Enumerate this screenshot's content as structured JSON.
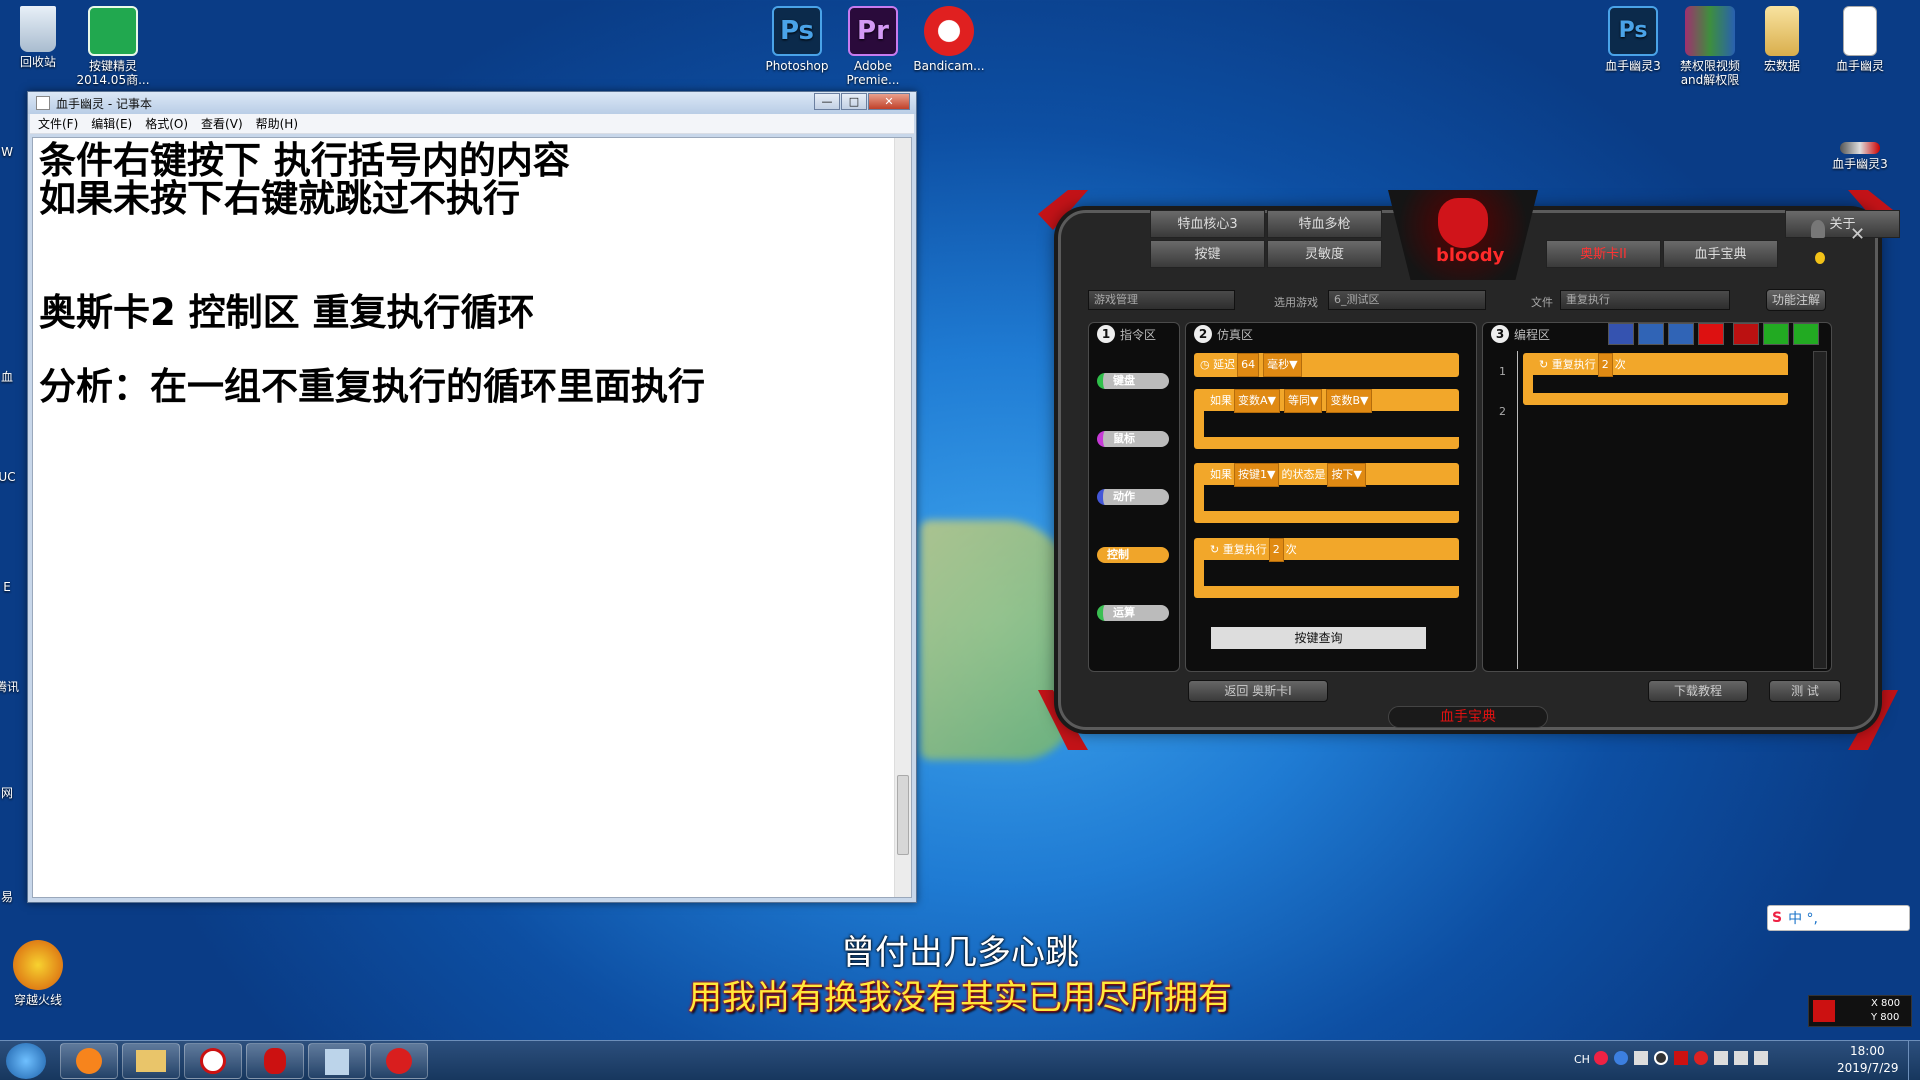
{
  "desktop": {
    "icons": [
      {
        "label": "回收站"
      },
      {
        "label": "按键精灵\n2014.05商..."
      },
      {
        "label": "Photoshop"
      },
      {
        "label": "Adobe\nPremie..."
      },
      {
        "label": "Bandicam..."
      },
      {
        "label": "血手幽灵3"
      },
      {
        "label": "禁权限视频\nand解权限"
      },
      {
        "label": "宏数据"
      },
      {
        "label": "血手幽灵"
      },
      {
        "label": "血手幽灵3"
      },
      {
        "label": "穿越火线"
      }
    ],
    "partial_labels": [
      "W",
      "血",
      "UC",
      "E",
      "腾讯",
      "网",
      "易"
    ]
  },
  "notepad": {
    "title": "血手幽灵 - 记事本",
    "menu": [
      "文件(F)",
      "编辑(E)",
      "格式(O)",
      "查看(V)",
      "帮助(H)"
    ],
    "window_buttons": [
      "—",
      "□",
      "✕"
    ],
    "lines": [
      "条件右键按下 执行括号内的内容",
      "如果未按下右键就跳过不执行",
      "",
      "",
      "奥斯卡2 控制区 重复执行循环",
      "",
      "分析：在一组不重复执行的循环里面执行"
    ]
  },
  "bloody": {
    "tabs_left_top": [
      "特血核心3",
      "特血多枪"
    ],
    "tabs_left_bottom": [
      "按键",
      "灵敏度"
    ],
    "tabs_right_top": [
      "关于"
    ],
    "tabs_right_bottom": [
      "奥斯卡II",
      "血手宝典"
    ],
    "logo": "bloody",
    "game_manage": "游戏管理",
    "select_game_label": "选用游戏",
    "select_game_value": "6_测试区",
    "file_label": "文件",
    "file_value": "重复执行",
    "func_btn": "功能注解",
    "panel1": {
      "num": "1",
      "title": "指令区",
      "cats": [
        "键盘",
        "鼠标",
        "动作",
        "控制",
        "运算"
      ],
      "cat_colors": [
        "#2fbf4a",
        "#c63ad6",
        "#4457d8",
        "#f0a52a",
        "#3bbf52"
      ]
    },
    "panel2": {
      "num": "2",
      "title": "仿真区",
      "b1": [
        "延迟",
        "64",
        "毫秒▼"
      ],
      "b2": [
        "如果",
        "变数A▼",
        "等同▼",
        "变数B▼"
      ],
      "b3": [
        "如果",
        "按键1▼",
        "的状态是",
        "按下▼"
      ],
      "b4": [
        "重复执行",
        "2",
        "次"
      ],
      "query": "按键查询"
    },
    "panel3": {
      "num": "3",
      "title": "编程区",
      "lines": [
        "1",
        "2"
      ],
      "block": [
        "重复执行",
        "2",
        "次"
      ]
    },
    "bottom_left": "返回 奥斯卡I",
    "bottom_help": "下载教程",
    "bottom_test": "测 试",
    "bottom_center": "血手宝典"
  },
  "subtitles": {
    "line1": "曾付出几多心跳",
    "line2": "用我尚有换我没有其实已用尽所拥有"
  },
  "tray": {
    "lang": "CH",
    "time": "18:00",
    "date": "2019/7/29",
    "ime": "中 °,",
    "coord_x": "X 800",
    "coord_y": "Y 800"
  }
}
